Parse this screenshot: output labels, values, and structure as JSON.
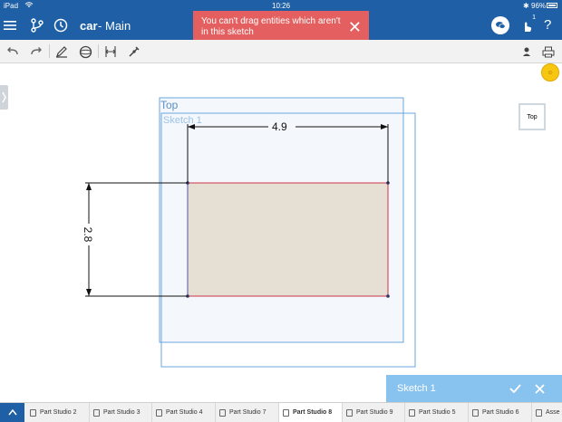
{
  "status": {
    "device": "iPad",
    "time": "10:26",
    "battery": "96%"
  },
  "header": {
    "doc_name": "car",
    "separator": "-",
    "branch": "Main",
    "help": "?",
    "notif_count": "1"
  },
  "toast": {
    "message": "You can't drag entities which aren't in this sketch"
  },
  "view": {
    "plane_label": "Top",
    "sketch_label": "Sketch 1",
    "cube_face": "Top"
  },
  "dimensions": {
    "width": "4.9",
    "height": "2.8"
  },
  "sketch_panel": {
    "title": "Sketch 1"
  },
  "tabs": [
    {
      "label": "Part Studio 2"
    },
    {
      "label": "Part Studio 3"
    },
    {
      "label": "Part Studio 4"
    },
    {
      "label": "Part Studio 7"
    },
    {
      "label": "Part Studio 8",
      "active": true
    },
    {
      "label": "Part Studio 9"
    },
    {
      "label": "Part Studio 5"
    },
    {
      "label": "Part Studio 6"
    },
    {
      "label": "Asse"
    }
  ],
  "colors": {
    "brand": "#1f5fa5",
    "toast": "#e46060",
    "panel": "#88c2ee",
    "plane": "#6aa7df",
    "fill": "#e5e0d3",
    "sketch_edge": "#cc3344"
  }
}
